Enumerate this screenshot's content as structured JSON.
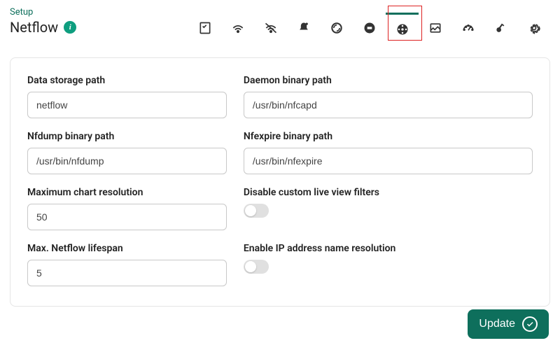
{
  "header": {
    "breadcrumb": "Setup",
    "title": "Netflow"
  },
  "toolbar": {
    "items": [
      {
        "name": "checklist-icon"
      },
      {
        "name": "wifi-icon"
      },
      {
        "name": "wifi-slash-icon"
      },
      {
        "name": "bell-icon"
      },
      {
        "name": "refresh-icon"
      },
      {
        "name": "circle-icon"
      },
      {
        "name": "target-icon",
        "active": true
      },
      {
        "name": "image-icon"
      },
      {
        "name": "gauge-icon"
      },
      {
        "name": "key-icon"
      },
      {
        "name": "gear-icon"
      }
    ]
  },
  "form": {
    "data_storage_path": {
      "label": "Data storage path",
      "value": "netflow"
    },
    "daemon_binary_path": {
      "label": "Daemon binary path",
      "value": "/usr/bin/nfcapd"
    },
    "nfdump_binary_path": {
      "label": "Nfdump binary path",
      "value": "/usr/bin/nfdump"
    },
    "nfexpire_binary_path": {
      "label": "Nfexpire binary path",
      "value": "/usr/bin/nfexpire"
    },
    "max_chart_resolution": {
      "label": "Maximum chart resolution",
      "value": "50"
    },
    "disable_custom_filters": {
      "label": "Disable custom live view filters",
      "value": false
    },
    "max_netflow_lifespan": {
      "label": "Max. Netflow lifespan",
      "value": "5"
    },
    "enable_ip_resolution": {
      "label": "Enable IP address name resolution",
      "value": false
    }
  },
  "actions": {
    "update": "Update"
  }
}
